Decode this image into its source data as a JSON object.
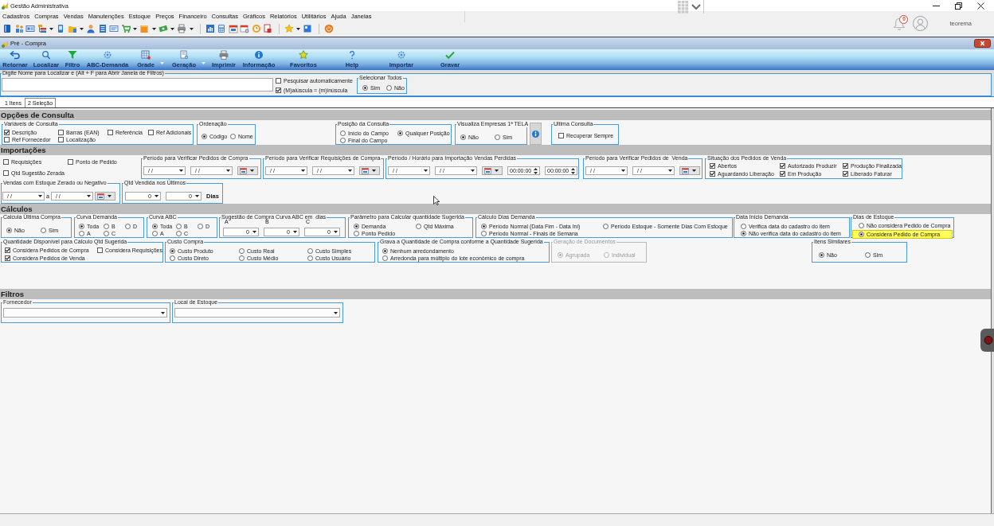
{
  "window": {
    "title": "Gestão Administrativa"
  },
  "menu": [
    "Cadastros",
    "Compras",
    "Vendas",
    "Manutenções",
    "Estoque",
    "Preços",
    "Financeiro",
    "Consultas",
    "Gráficos",
    "Relatórios",
    "Utilitários",
    "Ajuda",
    "Janelas"
  ],
  "notifications": {
    "count": "0"
  },
  "user": {
    "name": "teorema"
  },
  "child_window": {
    "title": "Pré - Compra"
  },
  "actions": [
    {
      "label": "Retornar",
      "dropdown": false
    },
    {
      "label": "Localizar",
      "dropdown": false
    },
    {
      "label": "Filtro",
      "dropdown": false
    },
    {
      "label": "ABC-Demanda",
      "dropdown": false
    },
    {
      "label": "Grade",
      "dropdown": true
    },
    {
      "label": "Geração",
      "dropdown": true
    },
    {
      "label": "Imprimir",
      "dropdown": false
    },
    {
      "label": "Informação",
      "dropdown": false
    },
    {
      "label": "Favoritos",
      "dropdown": false
    },
    {
      "label": "Help",
      "dropdown": false
    },
    {
      "label": "Importar",
      "dropdown": false
    },
    {
      "label": "Gravar",
      "dropdown": false
    }
  ],
  "search": {
    "label": "Digite Nome para Localizar e (Alt + F para Abrir Janela de Filtros)",
    "options": [
      {
        "label": "Pesquisar automaticamente",
        "checked": false
      },
      {
        "label": "(M)aiúscula = (m)inúscula",
        "checked": true
      }
    ],
    "select_all": {
      "title": "Selecionar Todos",
      "options": [
        {
          "label": "Sim",
          "selected": true
        },
        {
          "label": "Não",
          "selected": false
        }
      ]
    }
  },
  "tabs": [
    {
      "label": "1 Itens",
      "selected": false
    },
    {
      "label": "2 Seleção",
      "selected": true
    }
  ],
  "sections": [
    {
      "title": "Opções de Consulta",
      "rows": [
        {
          "groups": [
            {
              "kind": "group",
              "title": "Variáveis de Consulta",
              "disabled": false,
              "items": [
                {
                  "kind": "checkbox",
                  "label": "Descrição",
                  "checked": true
                },
                {
                  "kind": "checkbox",
                  "label": "Barras (EAN)",
                  "checked": false
                },
                {
                  "kind": "checkbox",
                  "label": "Referência",
                  "checked": false
                },
                {
                  "kind": "checkbox",
                  "label": "Ref Adicionais",
                  "checked": false
                },
                {
                  "kind": "checkbox",
                  "label": "Ref Fornecedor",
                  "checked": false
                },
                {
                  "kind": "checkbox",
                  "label": "Localização",
                  "checked": false
                }
              ]
            },
            {
              "kind": "group",
              "title": "Ordenação",
              "disabled": false,
              "items": [
                {
                  "kind": "radio",
                  "label": "Código",
                  "selected": true
                },
                {
                  "kind": "radio",
                  "label": "Nome",
                  "selected": false
                }
              ]
            },
            {
              "kind": "group",
              "title": "Posição da Consulta",
              "disabled": false,
              "items": [
                {
                  "kind": "radio",
                  "label": "Início do Campo",
                  "selected": false
                },
                {
                  "kind": "radio",
                  "label": "Qualquer Posição",
                  "selected": true
                },
                {
                  "kind": "radio",
                  "label": "Final do Campo",
                  "selected": false
                }
              ]
            },
            {
              "kind": "group",
              "title": "Visualiza Empresas 1ª TELA",
              "disabled": false,
              "items": [
                {
                  "kind": "radio",
                  "label": "Não",
                  "selected": true
                },
                {
                  "kind": "radio",
                  "label": "Sim",
                  "selected": false
                }
              ]
            },
            {
              "kind": "info-button",
              "disabled": false
            },
            {
              "kind": "group",
              "title": "Ultima Consulta",
              "disabled": false,
              "items": [
                {
                  "kind": "checkbox",
                  "label": "Recuperar Sempre",
                  "checked": false
                }
              ]
            }
          ]
        }
      ]
    },
    {
      "title": "Importações",
      "rows": [
        {
          "groups": [
            {
              "kind": "plain",
              "disabled": false,
              "items": [
                {
                  "kind": "checkbox",
                  "label": "Requisições",
                  "checked": false
                },
                {
                  "kind": "checkbox",
                  "label": "Ponto de Pedido",
                  "checked": false
                },
                {
                  "kind": "checkbox",
                  "label": "Qtd Sugestão Zerada",
                  "checked": false
                }
              ]
            },
            {
              "kind": "group",
              "title": "Período para Verificar Pedidos de Compra",
              "disabled": false,
              "items": [
                {
                  "kind": "date",
                  "value": "/ /"
                },
                {
                  "kind": "date",
                  "value": "/ /"
                },
                {
                  "kind": "calendar"
                }
              ]
            },
            {
              "kind": "group",
              "title": "Período para Verificar Requisições de Compra",
              "disabled": false,
              "items": [
                {
                  "kind": "date",
                  "value": "/ /"
                },
                {
                  "kind": "date",
                  "value": "/ /"
                },
                {
                  "kind": "calendar"
                }
              ]
            },
            {
              "kind": "group",
              "title": "Período / Horário para Importação Vendas Perdidas",
              "disabled": false,
              "items": [
                {
                  "kind": "date",
                  "value": "/ /"
                },
                {
                  "kind": "date",
                  "value": "/ /"
                },
                {
                  "kind": "calendar"
                },
                {
                  "kind": "time",
                  "value": "00:00:00"
                },
                {
                  "kind": "time",
                  "value": "00:00:00"
                }
              ]
            },
            {
              "kind": "group",
              "title": "Período para Verificar Pedidos de  Venda",
              "disabled": false,
              "items": [
                {
                  "kind": "date",
                  "value": "/ /"
                },
                {
                  "kind": "date",
                  "value": "/ /"
                },
                {
                  "kind": "calendar"
                }
              ]
            },
            {
              "kind": "group",
              "title": "Situação dos Pedidos de Venda",
              "disabled": false,
              "items": [
                {
                  "kind": "checkbox",
                  "label": "Abertos",
                  "checked": true
                },
                {
                  "kind": "checkbox",
                  "label": "Autorizado Produzir",
                  "checked": true
                },
                {
                  "kind": "checkbox",
                  "label": "Produção Finalizada",
                  "checked": true
                },
                {
                  "kind": "checkbox",
                  "label": "Aguardando Liberação",
                  "checked": true
                },
                {
                  "kind": "checkbox",
                  "label": "Em Produção",
                  "checked": true
                },
                {
                  "kind": "checkbox",
                  "label": "Liberado Faturar",
                  "checked": true
                }
              ]
            }
          ]
        },
        {
          "groups": [
            {
              "kind": "group",
              "title": "Vendas com Estoque Zerado ou Negativo",
              "disabled": false,
              "items": [
                {
                  "kind": "date",
                  "value": "/ /"
                },
                {
                  "kind": "text",
                  "value": "a"
                },
                {
                  "kind": "date",
                  "value": "/ /"
                },
                {
                  "kind": "calendar"
                }
              ]
            },
            {
              "kind": "group",
              "title": "Qtd Vendida nos Últimos",
              "disabled": false,
              "items": [
                {
                  "kind": "combo",
                  "value": "0"
                },
                {
                  "kind": "combo",
                  "value": "0"
                },
                {
                  "kind": "unit",
                  "value": "Dias"
                }
              ]
            }
          ]
        }
      ]
    },
    {
      "title": "Cálculos",
      "rows": [
        {
          "groups": [
            {
              "kind": "group",
              "title": "Calcula Última Compra",
              "disabled": false,
              "items": [
                {
                  "kind": "radio",
                  "label": "Não",
                  "selected": true
                },
                {
                  "kind": "radio",
                  "label": "Sim",
                  "selected": false
                }
              ]
            },
            {
              "kind": "group",
              "title": "Curva Demanda",
              "disabled": false,
              "items": [
                {
                  "kind": "radio",
                  "label": "Toda",
                  "selected": true
                },
                {
                  "kind": "radio",
                  "label": "B",
                  "selected": false
                },
                {
                  "kind": "radio",
                  "label": "D",
                  "selected": false
                },
                {
                  "kind": "radio",
                  "label": "A",
                  "selected": false
                },
                {
                  "kind": "radio",
                  "label": "C",
                  "selected": false
                }
              ]
            },
            {
              "kind": "group",
              "title": "Curva ABC",
              "disabled": false,
              "items": [
                {
                  "kind": "radio",
                  "label": "Toda",
                  "selected": true
                },
                {
                  "kind": "radio",
                  "label": "B",
                  "selected": false
                },
                {
                  "kind": "radio",
                  "label": "D",
                  "selected": false
                },
                {
                  "kind": "radio",
                  "label": "A",
                  "selected": false
                },
                {
                  "kind": "radio",
                  "label": "C",
                  "selected": false
                }
              ]
            },
            {
              "kind": "group",
              "title": "Sugestão de Compra Curva ABC em  dias",
              "disabled": false,
              "items": [
                {
                  "kind": "labeled-combo",
                  "label": "A",
                  "value": "0"
                },
                {
                  "kind": "labeled-combo",
                  "label": "B",
                  "value": "0"
                },
                {
                  "kind": "labeled-combo",
                  "label": "C",
                  "value": "0"
                }
              ]
            },
            {
              "kind": "group",
              "title": "Parâmetro para Calcular quantidade Sugerida",
              "disabled": false,
              "items": [
                {
                  "kind": "radio",
                  "label": "Demanda",
                  "selected": true
                },
                {
                  "kind": "radio",
                  "label": "Qtd Máxima",
                  "selected": false
                },
                {
                  "kind": "radio",
                  "label": "Ponto Pedido",
                  "selected": false
                }
              ]
            },
            {
              "kind": "group",
              "title": "Cálculo Dias Demanda",
              "disabled": false,
              "items": [
                {
                  "kind": "radio",
                  "label": "Período Normal (Data Fim - Data Ini)",
                  "selected": true
                },
                {
                  "kind": "radio",
                  "label": "Período Estoque - Somente Dias Com Estoque",
                  "selected": false
                },
                {
                  "kind": "radio",
                  "label": "Período Normal - Finais de Semana",
                  "selected": false
                }
              ]
            },
            {
              "kind": "group",
              "title": "Data Início Demanda",
              "disabled": false,
              "items": [
                {
                  "kind": "radio",
                  "label": "Verifica data do cadastro do item",
                  "selected": false
                },
                {
                  "kind": "radio",
                  "label": "Não verifica data do cadastro do item",
                  "selected": true
                }
              ]
            },
            {
              "kind": "group",
              "title": "Dias de Estoque",
              "disabled": false,
              "items": [
                {
                  "kind": "radio",
                  "label": "Não considera Pedido de Compra",
                  "selected": false,
                  "highlighted": false
                },
                {
                  "kind": "radio",
                  "label": "Considera Pedido de Compra",
                  "selected": true,
                  "highlighted": true
                }
              ]
            }
          ]
        },
        {
          "groups": [
            {
              "kind": "group",
              "title": "Quantidade Disponível para Cálculo Qtd Sugerida",
              "disabled": false,
              "items": [
                {
                  "kind": "checkbox",
                  "label": "Considera Pedidos de Compra",
                  "checked": true
                },
                {
                  "kind": "checkbox",
                  "label": "Considera Requisições",
                  "checked": false
                },
                {
                  "kind": "checkbox",
                  "label": "Considera Pedidos de Venda",
                  "checked": true
                }
              ]
            },
            {
              "kind": "group",
              "title": "Custo Compra",
              "disabled": false,
              "items": [
                {
                  "kind": "radio",
                  "label": "Custo Produto",
                  "selected": true
                },
                {
                  "kind": "radio",
                  "label": "Custo Real",
                  "selected": false
                },
                {
                  "kind": "radio",
                  "label": "Custo Simples",
                  "selected": false
                },
                {
                  "kind": "radio",
                  "label": "Custo Direto",
                  "selected": false
                },
                {
                  "kind": "radio",
                  "label": "Custo Médio",
                  "selected": false
                },
                {
                  "kind": "radio",
                  "label": "Custo Usuário",
                  "selected": false
                }
              ]
            },
            {
              "kind": "group",
              "title": "Grava a Quantidade de Compra conforme a Quantidade Sugerida",
              "disabled": false,
              "items": [
                {
                  "kind": "radio",
                  "label": "Nenhum arredondamento",
                  "selected": true
                },
                {
                  "kind": "radio",
                  "label": "Arredonda para múltiplo do lote econômico de compra",
                  "selected": false
                }
              ]
            },
            {
              "kind": "group",
              "title": "Geração de Documentos",
              "disabled": true,
              "items": [
                {
                  "kind": "radio",
                  "label": "Agrupada",
                  "selected": true
                },
                {
                  "kind": "radio",
                  "label": "Individual",
                  "selected": false
                }
              ]
            },
            {
              "kind": "group",
              "title": "Itens Similares",
              "disabled": false,
              "items": [
                {
                  "kind": "radio",
                  "label": "Não",
                  "selected": true
                },
                {
                  "kind": "radio",
                  "label": "Sim",
                  "selected": false
                }
              ]
            }
          ]
        }
      ]
    },
    {
      "title": "Filtros",
      "rows": [
        {
          "groups": [
            {
              "kind": "group",
              "title": "Fornecedor",
              "disabled": false,
              "items": [
                {
                  "kind": "combo"
                }
              ]
            },
            {
              "kind": "group",
              "title": "Local de Estoque",
              "disabled": false,
              "items": [
                {
                  "kind": "combo"
                }
              ]
            }
          ]
        }
      ]
    }
  ]
}
